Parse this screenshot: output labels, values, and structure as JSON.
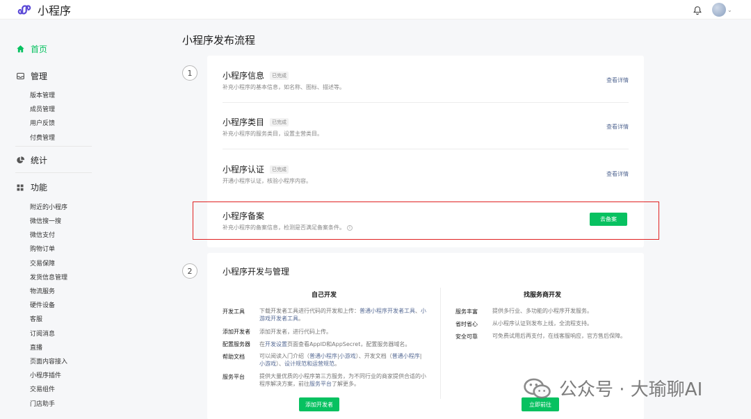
{
  "app": {
    "title": "小程序"
  },
  "sidebar": {
    "home": "首页",
    "manage": {
      "label": "管理",
      "items": [
        "版本管理",
        "成员管理",
        "用户反馈",
        "付费管理"
      ]
    },
    "stats": "统计",
    "features": {
      "label": "功能",
      "items": [
        "附近的小程序",
        "微信搜一搜",
        "微信支付",
        "购物订单",
        "交易保障",
        "发货信息管理",
        "物流服务",
        "硬件设备",
        "客服",
        "订阅消息",
        "直播",
        "页面内容接入",
        "小程序插件",
        "交易组件",
        "门店助手"
      ]
    }
  },
  "main": {
    "title": "小程序发布流程",
    "step1": "1",
    "step2": "2",
    "flow_items": [
      {
        "title": "小程序信息",
        "badge": "已完成",
        "desc": "补充小程序的基本信息，如名称、图标、描述等。",
        "link": "查看详情"
      },
      {
        "title": "小程序类目",
        "badge": "已完成",
        "desc": "补充小程序的服务类目，设置主营类目。",
        "link": "查看详情"
      },
      {
        "title": "小程序认证",
        "badge": "已完成",
        "desc": "开通小程序认证，核验小程序内容。",
        "link": "查看详情"
      },
      {
        "title": "小程序备案",
        "desc": "补充小程序的备案信息，检测是否满足备案条件。",
        "button": "去备案"
      }
    ],
    "dev": {
      "title": "小程序开发与管理",
      "self": {
        "heading": "自己开发",
        "rows": [
          {
            "label": "开发工具",
            "text_a": "下载开发者工具进行代码的开发和上传：",
            "link_a": "普通小程序开发者工具",
            "text_b": "、",
            "link_b": "小游戏开发者工具",
            "text_c": "。"
          },
          {
            "label": "添加开发者",
            "text_a": "添加开发者，进行代码上传。"
          },
          {
            "label": "配置服务器",
            "text_a": "在",
            "link_a": "开发设置",
            "text_b": "页面查看AppID和AppSecret，配置服务器域名。"
          },
          {
            "label": "帮助文档",
            "text_a": "可以阅读入门介绍（",
            "link_a": "普通小程序",
            "text_b": "|",
            "link_b": "小游戏",
            "text_c": "）、开发文档（",
            "link_c": "普通小程序",
            "text_d": "|",
            "link_d": "小游戏",
            "text_e": "）、",
            "link_e": "设计规范和运营规范",
            "text_f": "。"
          },
          {
            "label": "服务平台",
            "text_a": "提供大量优质的小程序第三方服务，为不同行业的商家提供合适的小程序解决方案，前往",
            "link_a": "服务平台",
            "text_b": "了解更多。"
          }
        ],
        "button": "添加开发者"
      },
      "provider": {
        "heading": "找服务商开发",
        "rows": [
          {
            "label": "服务丰富",
            "text": "提供多行业、多功能的小程序开发服务。"
          },
          {
            "label": "省时省心",
            "text": "从小程序认证到发布上线，全流程支持。"
          },
          {
            "label": "安全可靠",
            "text": "可免费试用后再支付，在线客服响应，官方售后保障。"
          }
        ],
        "button": "立即前往"
      }
    }
  },
  "watermark": "公众号 · 大瑜聊AI",
  "colors": {
    "accent": "#07c160",
    "link": "#576b95",
    "highlight": "#e02020"
  }
}
